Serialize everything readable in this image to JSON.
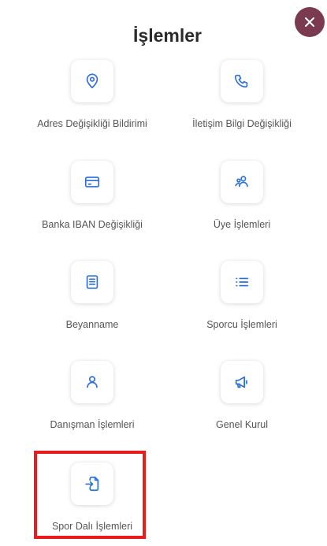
{
  "header": {
    "title": "İşlemler",
    "close_icon": "close-icon"
  },
  "colors": {
    "close_button_bg": "#7a3a4f",
    "icon_blue": "#2d6fd6",
    "label_text": "#555555",
    "highlight_border": "#e81c1c"
  },
  "menu": {
    "items": [
      {
        "label": "Adres Değişikliği Bildirimi",
        "icon": "location-pin-icon"
      },
      {
        "label": "İletişim Bilgi Değişikliği",
        "icon": "phone-icon"
      },
      {
        "label": "Banka IBAN Değişikliği",
        "icon": "credit-card-icon"
      },
      {
        "label": "Üye İşlemleri",
        "icon": "users-icon"
      },
      {
        "label": "Beyanname",
        "icon": "document-icon"
      },
      {
        "label": "Sporcu İşlemleri",
        "icon": "list-icon"
      },
      {
        "label": "Danışman İşlemleri",
        "icon": "user-icon"
      },
      {
        "label": "Genel Kurul",
        "icon": "megaphone-icon"
      },
      {
        "label": "Spor Dalı İşlemleri",
        "icon": "file-import-icon"
      }
    ]
  }
}
